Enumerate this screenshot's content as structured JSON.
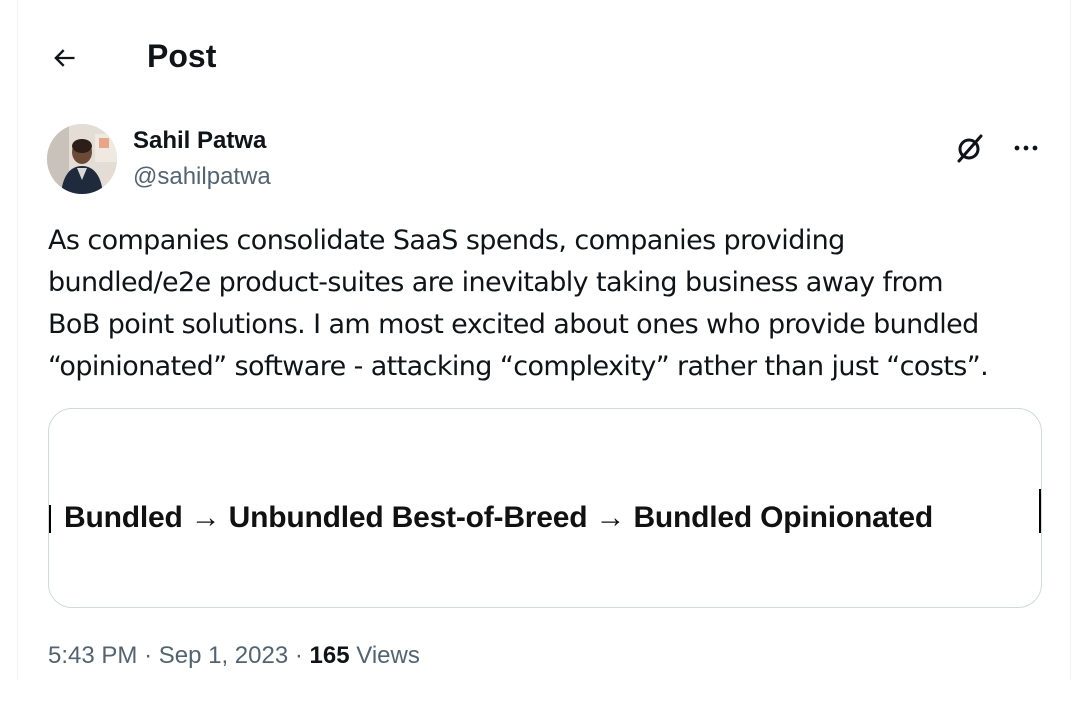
{
  "header": {
    "title": "Post",
    "back_icon": "arrow-left-icon"
  },
  "post": {
    "author": {
      "name": "Sahil Patwa",
      "handle": "@sahilpatwa"
    },
    "text_lines": [
      "As companies consolidate SaaS spends, companies providing",
      "bundled/e2e product-suites are inevitably taking business away from",
      "BoB point solutions. I am most excited about ones who provide bundled",
      "“opinionated” software - attacking “complexity” rather than just “costs”."
    ],
    "media": {
      "caption": "Bundled → Unbundled Best-of-Breed → Bundled Opinionated"
    },
    "meta": {
      "time": "5:43 PM",
      "separator": "·",
      "date": "Sep 1, 2023",
      "views_count": "165",
      "views_label": "Views"
    }
  },
  "icons": {
    "grok": "grok-icon",
    "more": "more-icon"
  },
  "colors": {
    "text": "#0f1419",
    "secondary": "#536471",
    "border": "#cfd9de"
  }
}
